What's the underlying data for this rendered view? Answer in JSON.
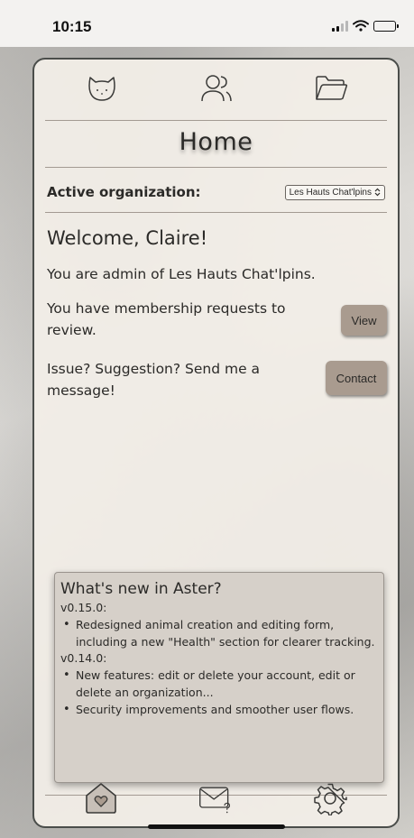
{
  "status_bar": {
    "time": "10:15"
  },
  "top_nav": {
    "items": [
      "cat-icon",
      "users-icon",
      "folder-icon"
    ]
  },
  "page": {
    "title": "Home"
  },
  "organization": {
    "label": "Active organization:",
    "selected": "Les Hauts Chat'lpins"
  },
  "welcome": "Welcome, Claire!",
  "admin_text": "You are admin of Les Hauts Chat'lpins.",
  "membership": {
    "text": "You have membership requests to review.",
    "button": "View"
  },
  "contact": {
    "text": "Issue? Suggestion? Send me a message!",
    "button": "Contact"
  },
  "whats_new": {
    "title": "What's new in Aster?",
    "versions": [
      {
        "version": "v0.15.0:",
        "items": [
          "Redesigned animal creation and editing form, including a new \"Health\" section for clearer tracking."
        ]
      },
      {
        "version": "v0.14.0:",
        "items": [
          "New features: edit or delete your account, edit or delete an organization...",
          "Security improvements and smoother user flows."
        ]
      }
    ]
  },
  "bottom_nav": {
    "items": [
      "home-heart-icon",
      "mail-icon",
      "settings-icon"
    ],
    "active": "home-heart-icon"
  },
  "colors": {
    "button": "#a99b8f",
    "frame_bg": "#f3efe8",
    "rule": "#a39a92"
  }
}
